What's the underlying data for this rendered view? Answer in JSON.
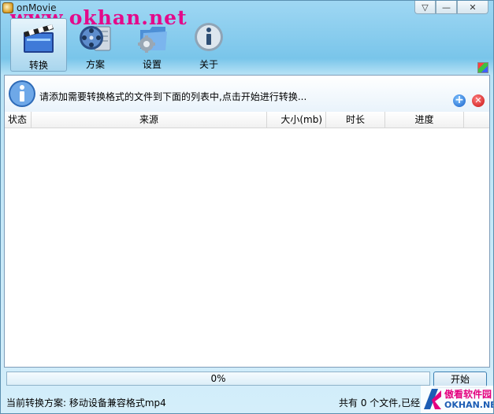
{
  "window": {
    "title": "onMovie",
    "watermark": "www.okhan.net"
  },
  "window_controls": {
    "dropdown": "▽",
    "minimize": "—",
    "close": "✕"
  },
  "toolbar": {
    "items": [
      {
        "label": "转换",
        "icon": "film-clapper-icon"
      },
      {
        "label": "方案",
        "icon": "film-reel-icon"
      },
      {
        "label": "设置",
        "icon": "settings-folder-icon"
      },
      {
        "label": "关于",
        "icon": "info-icon"
      }
    ]
  },
  "info_bar": {
    "message": "请添加需要转换格式的文件到下面的列表中,点击开始进行转换..."
  },
  "table": {
    "columns": [
      "状态",
      "来源",
      "大小(mb)",
      "时长",
      "进度"
    ],
    "rows": []
  },
  "progress": {
    "value": 0,
    "label": "0%"
  },
  "start_button": {
    "label": "开始"
  },
  "status_bar": {
    "current_scheme": "当前转换方案: 移动设备兼容格式mp4",
    "file_count": "共有 0 个文件,已经"
  },
  "logo": {
    "cn": "傲看软件园",
    "en": "OKHAN.NET"
  },
  "colors": {
    "watermark": "#e30a8a",
    "logo_pink": "#e4007f",
    "logo_blue": "#1c5db4",
    "accent": "#79c5ea"
  }
}
